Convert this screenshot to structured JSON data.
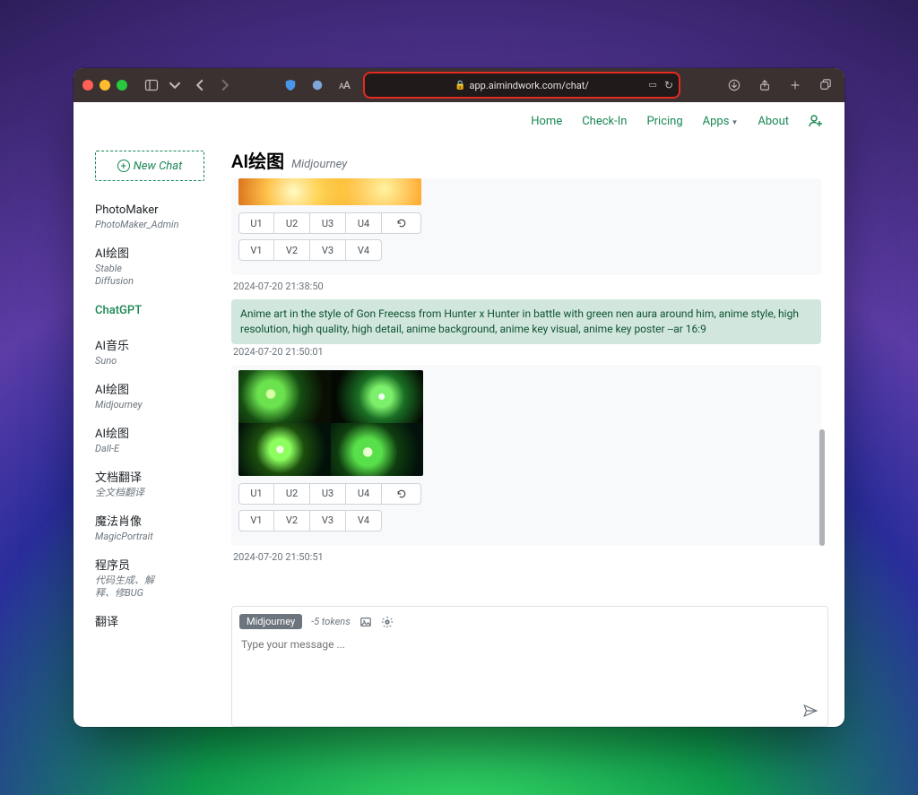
{
  "browser": {
    "url": "app.aimindwork.com/chat/"
  },
  "nav": {
    "home": "Home",
    "checkin": "Check-In",
    "pricing": "Pricing",
    "apps": "Apps",
    "about": "About"
  },
  "sidebar": {
    "newchat": "New Chat",
    "items": [
      {
        "title": "PhotoMaker",
        "sub": "PhotoMaker_Admin"
      },
      {
        "title": "AI绘图",
        "sub": "Stable\nDiffusion"
      },
      {
        "title": "ChatGPT",
        "sub": ""
      },
      {
        "title": "AI音乐",
        "sub": "Suno"
      },
      {
        "title": "AI绘图",
        "sub": "Midjourney"
      },
      {
        "title": "AI绘图",
        "sub": "Dall-E"
      },
      {
        "title": "文档翻译",
        "sub": "全文档翻译"
      },
      {
        "title": "魔法肖像",
        "sub": "MagicPortrait"
      },
      {
        "title": "程序员",
        "sub": "代码生成、解\n释、修BUG"
      },
      {
        "title": "翻译",
        "sub": ""
      }
    ]
  },
  "page": {
    "title": "AI绘图",
    "subtitle": "Midjourney"
  },
  "thread": {
    "msg1_time": "2024-07-20 21:38:50",
    "prompt_text": "Anime art in the style of Gon Freecss from Hunter x Hunter in battle with green nen aura around him, anime style, high resolution, high quality, high detail, anime background, anime key visual, anime key poster --ar 16:9",
    "msg2_time": "2024-07-20 21:50:01",
    "msg3_time": "2024-07-20 21:50:51",
    "u": [
      "U1",
      "U2",
      "U3",
      "U4"
    ],
    "v": [
      "V1",
      "V2",
      "V3",
      "V4"
    ]
  },
  "composer": {
    "badge": "Midjourney",
    "tokens": "-5 tokens",
    "placeholder": "Type your message ..."
  }
}
